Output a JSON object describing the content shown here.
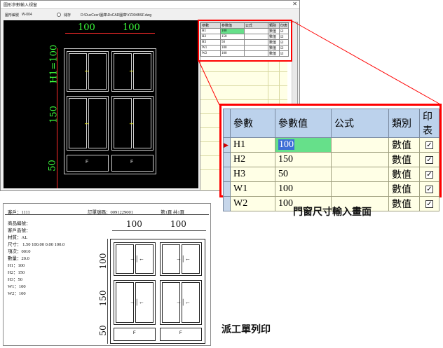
{
  "dialog": {
    "title": "圖形參數輸入視窗",
    "close_glyph": "✕",
    "toolbar": {
      "shape_id_label": "圖形編號",
      "shape_id_value": "W-004",
      "radio_label": "儲存",
      "file_path": "D:\\DucCecr\\圖庫\\DxCAD圖庫\\YZ004BSF.dwg"
    },
    "cad": {
      "dim_top_left": "100",
      "dim_top_right": "100",
      "dim_left_top": "H1=100",
      "dim_left_mid": "150",
      "dim_left_bot": "50",
      "panel_label": "F"
    },
    "small_table": {
      "headers": [
        "參數",
        "參數值",
        "公式",
        "類別",
        "印表"
      ],
      "rows": [
        {
          "param": "H1",
          "value": "100",
          "formula": "",
          "type": "數值"
        },
        {
          "param": "H2",
          "value": "150",
          "formula": "",
          "type": "數值"
        },
        {
          "param": "H3",
          "value": "50",
          "formula": "",
          "type": "數值"
        },
        {
          "param": "W1",
          "value": "100",
          "formula": "",
          "type": "數值"
        },
        {
          "param": "W2",
          "value": "100",
          "formula": "",
          "type": "數值"
        }
      ]
    }
  },
  "big_table": {
    "headers": [
      "參數",
      "參數值",
      "公式",
      "類別",
      "印表"
    ],
    "rows": [
      {
        "param": "H1",
        "value": "100",
        "formula": "",
        "type": "數值",
        "print": true
      },
      {
        "param": "H2",
        "value": "150",
        "formula": "",
        "type": "數值",
        "print": true
      },
      {
        "param": "H3",
        "value": "50",
        "formula": "",
        "type": "數值",
        "print": true
      },
      {
        "param": "W1",
        "value": "100",
        "formula": "",
        "type": "數值",
        "print": true
      },
      {
        "param": "W2",
        "value": "100",
        "formula": "",
        "type": "數值",
        "print": true
      }
    ]
  },
  "captions": {
    "input_screen": "門窗尺寸輸入畫面",
    "work_order": "派工單列印"
  },
  "print": {
    "customer": "客戶：1111",
    "order_no": "訂單號碼：0091229001",
    "page": "第1頁 共1頁",
    "lines": [
      "商品編號：",
      "客戶品號：",
      "材質：AL",
      "尺寸：  1.50  100.00   0.00  100.0",
      "項次：0010",
      "數量：20.0",
      "H1：100",
      "H2：150",
      "H3：50",
      "W1：100",
      "W2：100"
    ],
    "dim_top_left": "100",
    "dim_top_right": "100",
    "dim_left_top": "100",
    "dim_left_mid": "150",
    "dim_left_bot": "50",
    "panel_label": "F"
  },
  "colors": {
    "cad_dim": "#3cff3c",
    "highlight": "#ff0000",
    "selected_cell": "#66e08a",
    "header_blue": "#bcd2ec"
  }
}
